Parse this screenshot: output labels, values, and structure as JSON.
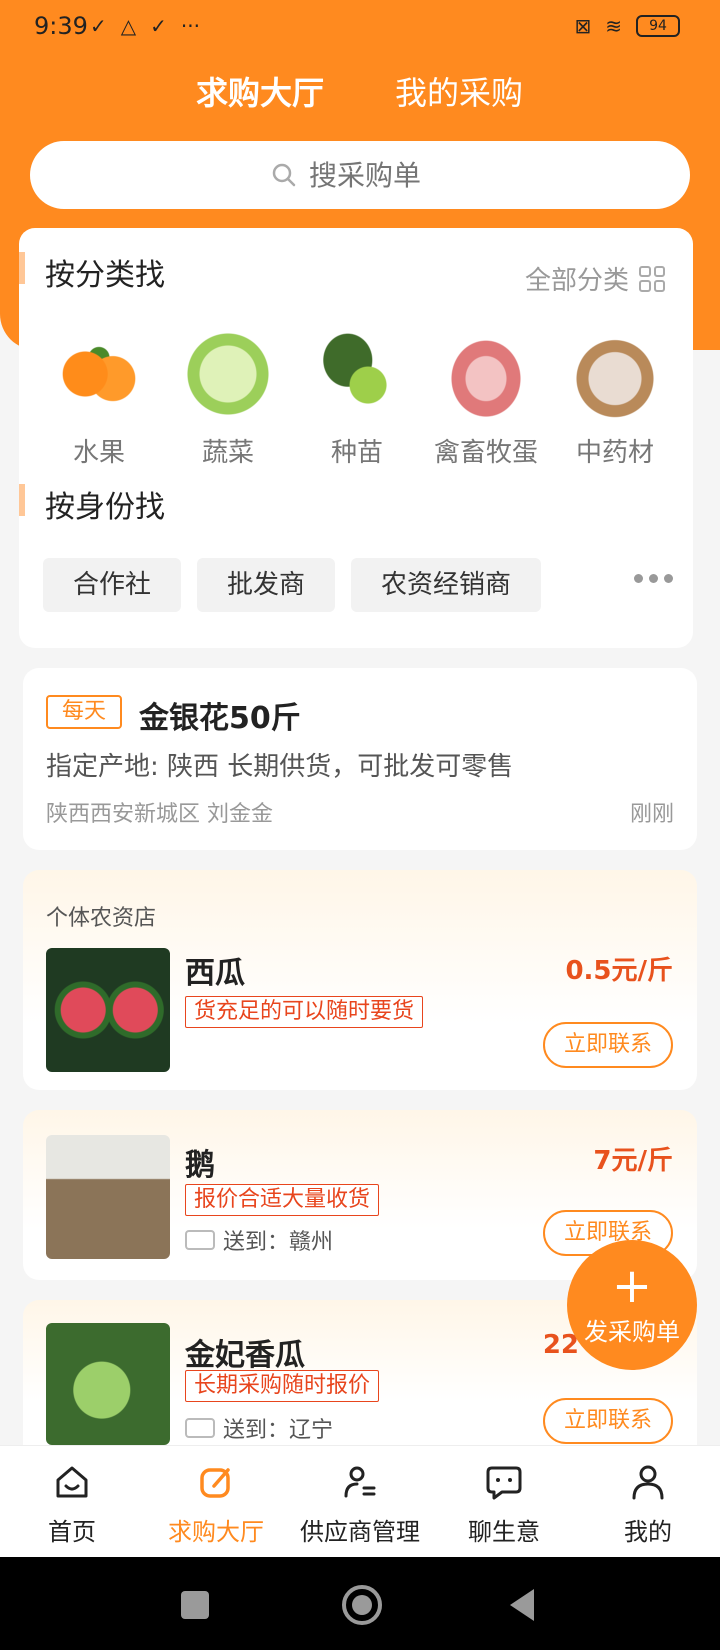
{
  "status": {
    "time": "9:39",
    "battery": "94"
  },
  "tabs": {
    "active": "求购大厅",
    "inactive": "我的采购"
  },
  "search": {
    "placeholder": "搜采购单"
  },
  "category_section": {
    "title": "按分类找",
    "all_label": "全部分类",
    "items": [
      {
        "label": "水果"
      },
      {
        "label": "蔬菜"
      },
      {
        "label": "种苗"
      },
      {
        "label": "禽畜牧蛋"
      },
      {
        "label": "中药材"
      }
    ]
  },
  "role_section": {
    "title": "按身份找",
    "chips": [
      "合作社",
      "批发商",
      "农资经销商"
    ]
  },
  "feed": {
    "tag": "每天",
    "title": "金银花50斤",
    "desc": "指定产地: 陕西 长期供货，可批发可零售",
    "location": "陕西西安新城区 刘金金",
    "time": "刚刚"
  },
  "offers": [
    {
      "store": "个体农资店",
      "name": "西瓜",
      "tag": "货充足的可以随时要货",
      "price": "0.5元/斤",
      "contact": "立即联系",
      "ship": ""
    },
    {
      "store": "",
      "name": "鹅",
      "tag": "报价合适大量收货",
      "price": "7元/斤",
      "contact": "立即联系",
      "ship": "送到：赣州"
    },
    {
      "store": "",
      "name": "金妃香瓜",
      "tag": "长期采购随时报价",
      "price": "22",
      "contact": "立即联系",
      "ship": "送到：辽宁"
    }
  ],
  "fab": {
    "label": "发采购单"
  },
  "nav": [
    {
      "label": "首页"
    },
    {
      "label": "求购大厅"
    },
    {
      "label": "供应商管理"
    },
    {
      "label": "聊生意"
    },
    {
      "label": "我的"
    }
  ]
}
